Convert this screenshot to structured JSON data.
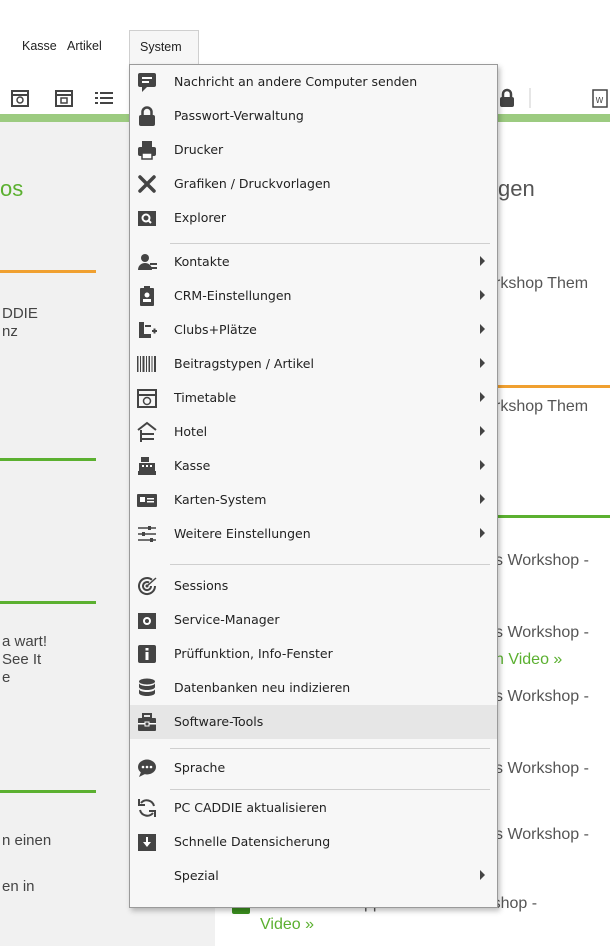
{
  "menubar": {
    "kasse": "Kasse",
    "artikel": "Artikel",
    "system": "System"
  },
  "background": {
    "left_heading": "os",
    "right_heading": "gen",
    "left_texts": [
      "DDIE",
      "nz",
      "a wart!",
      "See It",
      "e",
      "n einen",
      "en in"
    ],
    "right_texts": [
      "rkshop Them",
      "rkshop Them",
      "s Workshop -",
      "s Workshop -",
      "n Video »",
      "s Workshop -",
      "s Workshop -",
      "s Workshop -",
      "PC CADDIE Tipps & Tricks Workshop -",
      "Video »"
    ]
  },
  "menu": {
    "items": [
      {
        "label": "Nachricht an andere Computer senden",
        "icon": "message-icon",
        "submenu": false
      },
      {
        "label": "Passwort-Verwaltung",
        "icon": "lock-icon",
        "submenu": false
      },
      {
        "label": "Drucker",
        "icon": "printer-icon",
        "submenu": false
      },
      {
        "label": "Grafiken / Druckvorlagen",
        "icon": "scissors-icon",
        "submenu": false
      },
      {
        "label": "Explorer",
        "icon": "folder-search-icon",
        "submenu": false
      },
      {
        "label": "Kontakte",
        "icon": "contacts-icon",
        "submenu": true
      },
      {
        "label": "CRM-Einstellungen",
        "icon": "crm-badge-icon",
        "submenu": true
      },
      {
        "label": "Clubs+Plätze",
        "icon": "clubs-icon",
        "submenu": true
      },
      {
        "label": "Beitragstypen / Artikel",
        "icon": "barcode-icon",
        "submenu": true
      },
      {
        "label": "Timetable",
        "icon": "calendar-icon",
        "submenu": true
      },
      {
        "label": "Hotel",
        "icon": "hotel-icon",
        "submenu": true
      },
      {
        "label": "Kasse",
        "icon": "cash-register-icon",
        "submenu": true
      },
      {
        "label": "Karten-System",
        "icon": "card-icon",
        "submenu": true
      },
      {
        "label": "Weitere Einstellungen",
        "icon": "sliders-icon",
        "submenu": true
      },
      {
        "label": "Sessions",
        "icon": "sessions-icon",
        "submenu": false
      },
      {
        "label": "Service-Manager",
        "icon": "service-icon",
        "submenu": false
      },
      {
        "label": "Prüffunktion, Info-Fenster",
        "icon": "info-icon",
        "submenu": false
      },
      {
        "label": "Datenbanken neu indizieren",
        "icon": "database-icon",
        "submenu": false
      },
      {
        "label": "Software-Tools",
        "icon": "toolbox-icon",
        "submenu": false
      },
      {
        "label": "Sprache",
        "icon": "speech-bubble-icon",
        "submenu": false
      },
      {
        "label": "PC CADDIE aktualisieren",
        "icon": "refresh-icon",
        "submenu": false
      },
      {
        "label": "Schnelle Datensicherung",
        "icon": "backup-download-icon",
        "submenu": false
      },
      {
        "label": "Spezial",
        "icon": "",
        "submenu": true
      }
    ],
    "highlighted": "Software-Tools"
  },
  "colors": {
    "accent_green": "#5bb030",
    "orange": "#f0a030",
    "menu_bg": "#f7f7f7",
    "highlight_bg": "#e6e6e6"
  }
}
